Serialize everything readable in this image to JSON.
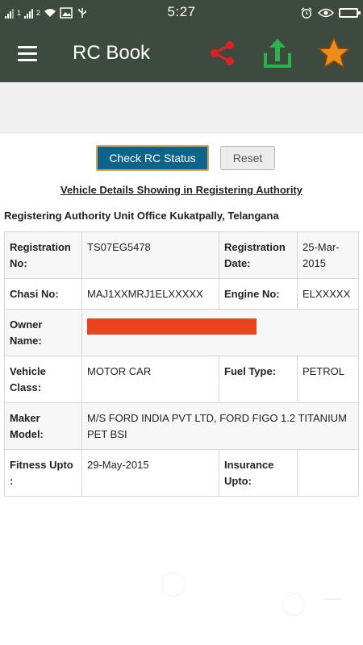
{
  "status_bar": {
    "sim1": "1",
    "sim2": "2",
    "time": "5:27"
  },
  "app_bar": {
    "title": "RC Book",
    "colors": {
      "background": "#3d4a3f",
      "share": "#e02020",
      "upload": "#29b34a",
      "star": "#f08a1a"
    }
  },
  "actions": {
    "check_label": "Check RC Status",
    "reset_label": "Reset"
  },
  "heading": "Vehicle Details Showing in Registering Authority",
  "office": "Registering Authority Unit Office Kukatpally, Telangana",
  "details": {
    "reg_no_label": "Registration No:",
    "reg_no": "TS07EG5478",
    "reg_date_label": "Registration Date:",
    "reg_date": "25-Mar-2015",
    "chasi_label": "Chasi No:",
    "chasi": "MAJ1XXMRJ1ELXXXXX",
    "engine_label": "Engine No:",
    "engine": "ELXXXXX",
    "owner_label": "Owner Name:",
    "class_label": "Vehicle Class:",
    "class": "MOTOR CAR",
    "fuel_label": "Fuel Type:",
    "fuel": "PETROL",
    "maker_label": "Maker Model:",
    "maker": "M/S FORD INDIA PVT LTD, FORD FIGO 1.2 TITANIUM PET BSI",
    "fitness_label": "Fitness Upto :",
    "fitness": "29-May-2015",
    "insurance_label": "Insurance Upto:",
    "insurance": ""
  }
}
